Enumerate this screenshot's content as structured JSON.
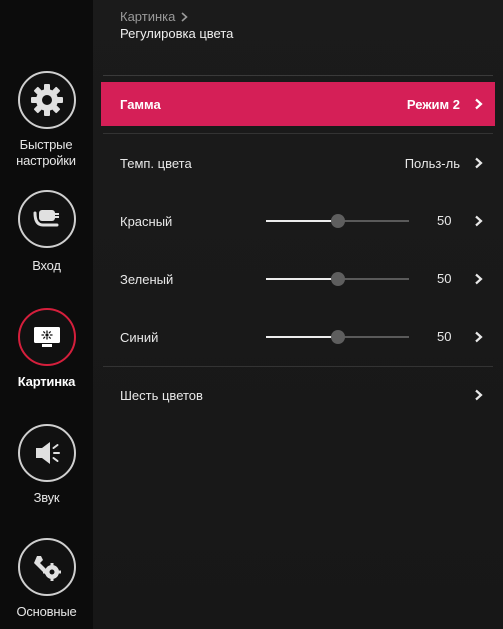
{
  "sidebar": {
    "items": [
      {
        "label": "Быстрые настройки",
        "icon": "gear-icon"
      },
      {
        "label": "Вход",
        "icon": "input-icon"
      },
      {
        "label": "Картинка",
        "icon": "picture-icon",
        "active": true
      },
      {
        "label": "Звук",
        "icon": "speaker-icon"
      },
      {
        "label": "Основные",
        "icon": "tools-icon"
      }
    ]
  },
  "header": {
    "breadcrumb": "Картинка",
    "title": "Регулировка цвета"
  },
  "rows": {
    "gamma": {
      "label": "Гамма",
      "value": "Режим 2"
    },
    "color_temp": {
      "label": "Темп. цвета",
      "value": "Польз-ль"
    },
    "red": {
      "label": "Красный",
      "value": "50",
      "level": 50
    },
    "green": {
      "label": "Зеленый",
      "value": "50",
      "level": 50
    },
    "blue": {
      "label": "Синий",
      "value": "50",
      "level": 50
    },
    "six_colors": {
      "label": "Шесть цветов"
    }
  },
  "colors": {
    "accent": "#d51f57",
    "active_ring": "#d51f3c"
  }
}
